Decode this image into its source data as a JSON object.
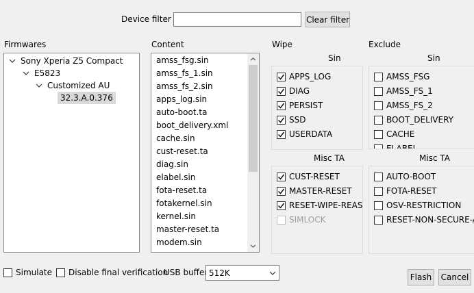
{
  "filter": {
    "label": "Device filter :",
    "value": "",
    "clear_label": "Clear filter"
  },
  "firmwares": {
    "title": "Firmwares",
    "tree": [
      {
        "label": "Sony Xperia Z5 Compact",
        "expanded": true
      },
      {
        "label": "E5823",
        "expanded": true
      },
      {
        "label": "Customized AU",
        "expanded": true
      },
      {
        "label": "32.3.A.0.376",
        "selected": true
      }
    ]
  },
  "content": {
    "title": "Content",
    "items": [
      "amss_fsg.sin",
      "amss_fs_1.sin",
      "amss_fs_2.sin",
      "apps_log.sin",
      "auto-boot.ta",
      "boot_delivery.xml",
      "cache.sin",
      "cust-reset.ta",
      "diag.sin",
      "elabel.sin",
      "fota-reset.ta",
      "fotakernel.sin",
      "kernel.sin",
      "master-reset.ta",
      "modem.sin"
    ]
  },
  "wipe": {
    "title": "Wipe",
    "sin_title": "Sin",
    "sin_items": [
      {
        "label": "APPS_LOG",
        "checked": true
      },
      {
        "label": "DIAG",
        "checked": true
      },
      {
        "label": "PERSIST",
        "checked": true
      },
      {
        "label": "SSD",
        "checked": true
      },
      {
        "label": "USERDATA",
        "checked": true
      }
    ],
    "ta_title": "Misc TA",
    "ta_items": [
      {
        "label": "CUST-RESET",
        "checked": true
      },
      {
        "label": "MASTER-RESET",
        "checked": true
      },
      {
        "label": "RESET-WIPE-REASON",
        "checked": true
      },
      {
        "label": "SIMLOCK",
        "checked": false,
        "disabled": true
      }
    ]
  },
  "exclude": {
    "title": "Exclude",
    "sin_title": "Sin",
    "sin_items": [
      {
        "label": "AMSS_FSG",
        "checked": false
      },
      {
        "label": "AMSS_FS_1",
        "checked": false
      },
      {
        "label": "AMSS_FS_2",
        "checked": false
      },
      {
        "label": "BOOT_DELIVERY",
        "checked": false
      },
      {
        "label": "CACHE",
        "checked": false
      },
      {
        "label": "ELABEL",
        "checked": false
      }
    ],
    "ta_title": "Misc TA",
    "ta_items": [
      {
        "label": "AUTO-BOOT",
        "checked": false
      },
      {
        "label": "FOTA-RESET",
        "checked": false
      },
      {
        "label": "OSV-RESTRICTION",
        "checked": false
      },
      {
        "label": "RESET-NON-SECURE-ADB",
        "checked": false
      }
    ]
  },
  "options": {
    "simulate_label": "Simulate",
    "simulate_checked": false,
    "disable_verification_label": "Disable final verification",
    "disable_verification_checked": false,
    "usb_buffer_label": "USB buffer",
    "usb_buffer_value": "512K"
  },
  "actions": {
    "flash_label": "Flash",
    "cancel_label": "Cancel"
  },
  "icons": {
    "tree_expanded": "chevron-down-icon",
    "scroll_up": "arrow-up-icon",
    "scroll_down": "arrow-down-icon",
    "dropdown": "chevron-down-icon",
    "check": "checkmark-icon"
  }
}
